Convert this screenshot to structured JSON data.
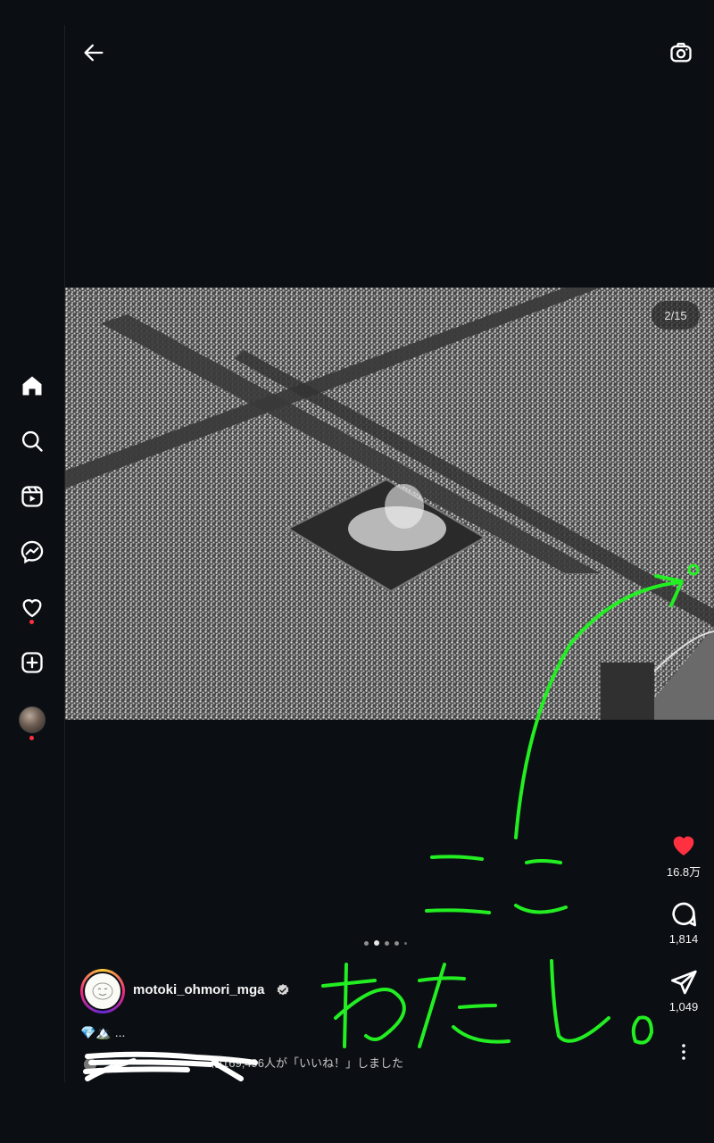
{
  "nav": {
    "items": [
      {
        "name": "home"
      },
      {
        "name": "search"
      },
      {
        "name": "reels"
      },
      {
        "name": "messenger"
      },
      {
        "name": "notifications"
      },
      {
        "name": "create"
      },
      {
        "name": "profile"
      }
    ]
  },
  "post": {
    "counter": "2/15",
    "likes_count": "16.8万",
    "comments_count": "1,814",
    "shares_count": "1,049",
    "username": "motoki_ohmori_mga",
    "caption": "💎🏔️ ...",
    "liked_by_text": "他169,496人が「いいね！」しました",
    "carousel_total_dots": 5,
    "carousel_active_index": 1
  },
  "annotation": {
    "text_here": "ここ",
    "text_me": "わたし。",
    "ink_color": "#22ee22"
  },
  "colors": {
    "background": "#0b0e13",
    "heart": "#ff3040",
    "accent_green": "#22ee22"
  }
}
